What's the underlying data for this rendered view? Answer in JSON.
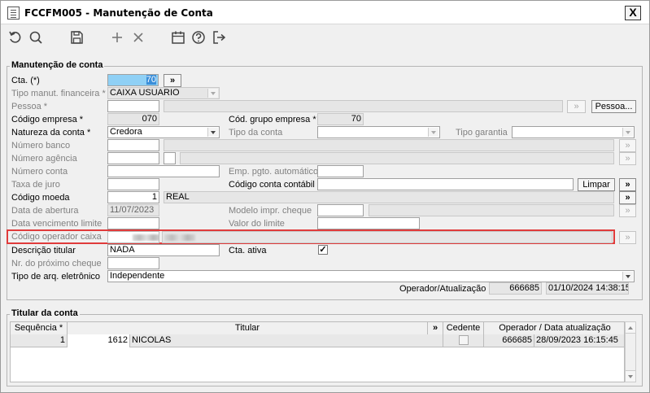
{
  "window": {
    "title": "FCCFM005 - Manutenção de Conta",
    "close": "X"
  },
  "form": {
    "group_title": "Manutenção de conta",
    "cta": {
      "label": "Cta. (*)",
      "value": "70",
      "search": "»"
    },
    "tipo_manut": {
      "label": "Tipo manut. financeira *",
      "value": "CAIXA USUARIO"
    },
    "pessoa": {
      "label": "Pessoa *",
      "value": "",
      "button": "Pessoa...",
      "search": "»"
    },
    "cod_empresa": {
      "label": "Código empresa *",
      "value": "070"
    },
    "cod_grupo": {
      "label": "Cód. grupo empresa *",
      "value": "70"
    },
    "natureza": {
      "label": "Natureza da conta *",
      "value": "Credora"
    },
    "tipo_conta": {
      "label": "Tipo da conta",
      "value": ""
    },
    "tipo_garantia": {
      "label": "Tipo garantia",
      "value": ""
    },
    "numero_banco": {
      "label": "Número banco",
      "value": "",
      "search": "»"
    },
    "numero_agencia": {
      "label": "Número agência",
      "value": "",
      "search": "»"
    },
    "numero_conta": {
      "label": "Número conta",
      "value": ""
    },
    "emp_pgto": {
      "label": "Emp. pgto. automático",
      "value": ""
    },
    "taxa_juro": {
      "label": "Taxa de juro",
      "value": ""
    },
    "cod_contabil": {
      "label": "Código conta contábil",
      "value": "",
      "button": "Limpar",
      "search": "»"
    },
    "cod_moeda": {
      "label": "Código moeda",
      "value": "1",
      "desc": "REAL",
      "search": "»"
    },
    "data_abertura": {
      "label": "Data de abertura",
      "value": "11/07/2023"
    },
    "modelo_cheque": {
      "label": "Modelo impr. cheque",
      "value": "",
      "search": "»"
    },
    "data_venc": {
      "label": "Data vencimento limite",
      "value": ""
    },
    "valor_limite": {
      "label": "Valor do limite",
      "value": ""
    },
    "cod_operador": {
      "label": "Código operador caixa",
      "value": "",
      "search": "»"
    },
    "descricao": {
      "label": "Descrição titular",
      "value": "NADA"
    },
    "cta_ativa": {
      "label": "Cta. ativa",
      "check": "✓"
    },
    "nr_cheque": {
      "label": "Nr. do próximo cheque",
      "value": ""
    },
    "tipo_arq": {
      "label": "Tipo de arq. eletrônico",
      "value": "Independente"
    },
    "operador": {
      "label": "Operador/Atualização",
      "code": "666685",
      "datetime": "01/10/2024 14:38:15"
    }
  },
  "titular": {
    "group_title": "Titular da conta",
    "headers": {
      "sequencia": "Sequência *",
      "titular": "Titular",
      "more": "»",
      "cedente": "Cedente",
      "operador": "Operador / Data atualização"
    },
    "rows": [
      {
        "seq": "1",
        "codigo": "1612",
        "nome": "NICOLAS",
        "operador": "666685",
        "data": "28/09/2023 16:15:45"
      }
    ]
  }
}
